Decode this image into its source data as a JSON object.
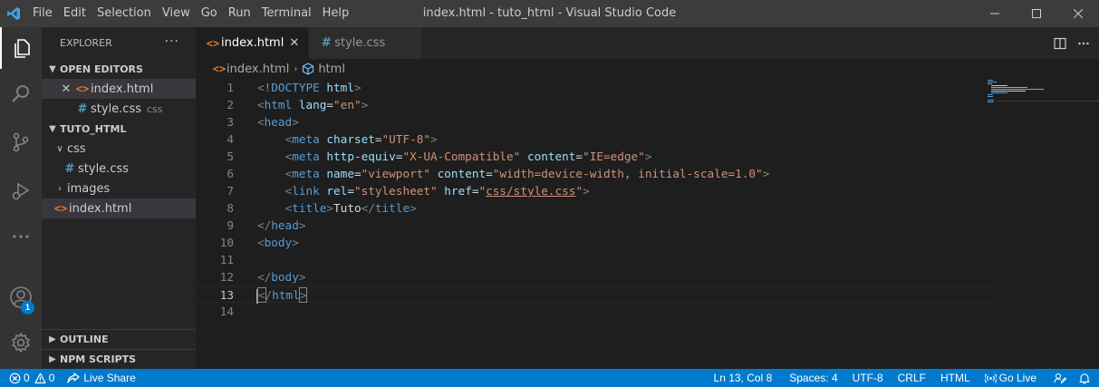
{
  "titlebar": {
    "menu": [
      "File",
      "Edit",
      "Selection",
      "View",
      "Go",
      "Run",
      "Terminal",
      "Help"
    ],
    "title": "index.html - tuto_html - Visual Studio Code"
  },
  "activity_bar": {
    "icons": [
      "files-icon",
      "search-icon",
      "source-control-icon",
      "run-debug-icon",
      "more-icon",
      "accounts-icon",
      "manage-gear-icon"
    ],
    "accounts_badge": "1"
  },
  "sidebar": {
    "title": "EXPLORER",
    "more": "···",
    "open_editors": {
      "header": "OPEN EDITORS",
      "items": [
        {
          "name": "index.html",
          "hint": ""
        },
        {
          "name": "style.css",
          "hint": "css"
        }
      ]
    },
    "workspace": {
      "header": "TUTO_HTML",
      "tree": [
        {
          "name": "css",
          "type": "folder",
          "expanded": true
        },
        {
          "name": "style.css",
          "type": "css"
        },
        {
          "name": "images",
          "type": "folder",
          "expanded": false
        },
        {
          "name": "index.html",
          "type": "html"
        }
      ]
    },
    "outline_header": "OUTLINE",
    "npm_header": "NPM SCRIPTS"
  },
  "tabs": [
    {
      "label": "index.html",
      "active": true
    },
    {
      "label": "style.css",
      "active": false
    }
  ],
  "breadcrumb": [
    "index.html",
    "html"
  ],
  "editor": {
    "current_line": 13,
    "line_numbers": [
      "1",
      "2",
      "3",
      "4",
      "5",
      "6",
      "7",
      "8",
      "9",
      "10",
      "11",
      "12",
      "13",
      "14"
    ],
    "lines": [
      [
        [
          "punc",
          "<"
        ],
        [
          "tag",
          "!DOCTYPE"
        ],
        [
          "text",
          " "
        ],
        [
          "attr",
          "html"
        ],
        [
          "punc",
          ">"
        ]
      ],
      [
        [
          "punc",
          "<"
        ],
        [
          "tag",
          "html"
        ],
        [
          "text",
          " "
        ],
        [
          "attr",
          "lang"
        ],
        [
          "text",
          "="
        ],
        [
          "str",
          "\"en\""
        ],
        [
          "punc",
          ">"
        ]
      ],
      [
        [
          "punc",
          "<"
        ],
        [
          "tag",
          "head"
        ],
        [
          "punc",
          ">"
        ]
      ],
      [
        [
          "text",
          "    "
        ],
        [
          "punc",
          "<"
        ],
        [
          "tag",
          "meta"
        ],
        [
          "text",
          " "
        ],
        [
          "attr",
          "charset"
        ],
        [
          "text",
          "="
        ],
        [
          "str",
          "\"UTF-8\""
        ],
        [
          "punc",
          ">"
        ]
      ],
      [
        [
          "text",
          "    "
        ],
        [
          "punc",
          "<"
        ],
        [
          "tag",
          "meta"
        ],
        [
          "text",
          " "
        ],
        [
          "attr",
          "http-equiv"
        ],
        [
          "text",
          "="
        ],
        [
          "str",
          "\"X-UA-Compatible\""
        ],
        [
          "text",
          " "
        ],
        [
          "attr",
          "content"
        ],
        [
          "text",
          "="
        ],
        [
          "str",
          "\"IE=edge\""
        ],
        [
          "punc",
          ">"
        ]
      ],
      [
        [
          "text",
          "    "
        ],
        [
          "punc",
          "<"
        ],
        [
          "tag",
          "meta"
        ],
        [
          "text",
          " "
        ],
        [
          "attr",
          "name"
        ],
        [
          "text",
          "="
        ],
        [
          "str",
          "\"viewport\""
        ],
        [
          "text",
          " "
        ],
        [
          "attr",
          "content"
        ],
        [
          "text",
          "="
        ],
        [
          "str",
          "\"width=device-width, initial-scale=1.0\""
        ],
        [
          "punc",
          ">"
        ]
      ],
      [
        [
          "text",
          "    "
        ],
        [
          "punc",
          "<"
        ],
        [
          "tag",
          "link"
        ],
        [
          "text",
          " "
        ],
        [
          "attr",
          "rel"
        ],
        [
          "text",
          "="
        ],
        [
          "str",
          "\"stylesheet\""
        ],
        [
          "text",
          " "
        ],
        [
          "attr",
          "href"
        ],
        [
          "text",
          "="
        ],
        [
          "str",
          "\""
        ],
        [
          "link",
          "css/style.css"
        ],
        [
          "str",
          "\""
        ],
        [
          "punc",
          ">"
        ]
      ],
      [
        [
          "text",
          "    "
        ],
        [
          "punc",
          "<"
        ],
        [
          "tag",
          "title"
        ],
        [
          "punc",
          ">"
        ],
        [
          "text",
          "Tuto"
        ],
        [
          "punc",
          "</"
        ],
        [
          "tag",
          "title"
        ],
        [
          "punc",
          ">"
        ]
      ],
      [
        [
          "punc",
          "</"
        ],
        [
          "tag",
          "head"
        ],
        [
          "punc",
          ">"
        ]
      ],
      [
        [
          "punc",
          "<"
        ],
        [
          "tag",
          "body"
        ],
        [
          "punc",
          ">"
        ]
      ],
      [],
      [
        [
          "punc",
          "</"
        ],
        [
          "tag",
          "body"
        ],
        [
          "punc",
          ">"
        ]
      ],
      [
        [
          "cursor",
          ""
        ],
        [
          "match",
          "<"
        ],
        [
          "punc",
          "/"
        ],
        [
          "tag",
          "html"
        ],
        [
          "match",
          ">"
        ]
      ],
      []
    ]
  },
  "statusbar": {
    "errors": "0",
    "warnings": "0",
    "live_share": "Live Share",
    "position": "Ln 13, Col 8",
    "spaces": "Spaces: 4",
    "encoding": "UTF-8",
    "eol": "CRLF",
    "language": "HTML",
    "go_live": "Go Live"
  },
  "colors": {
    "accent": "#007acc",
    "html_icon": "#e37933",
    "css_icon": "#519aba",
    "tag": "#569cd6",
    "attribute": "#9cdcfe",
    "string": "#ce9178"
  }
}
